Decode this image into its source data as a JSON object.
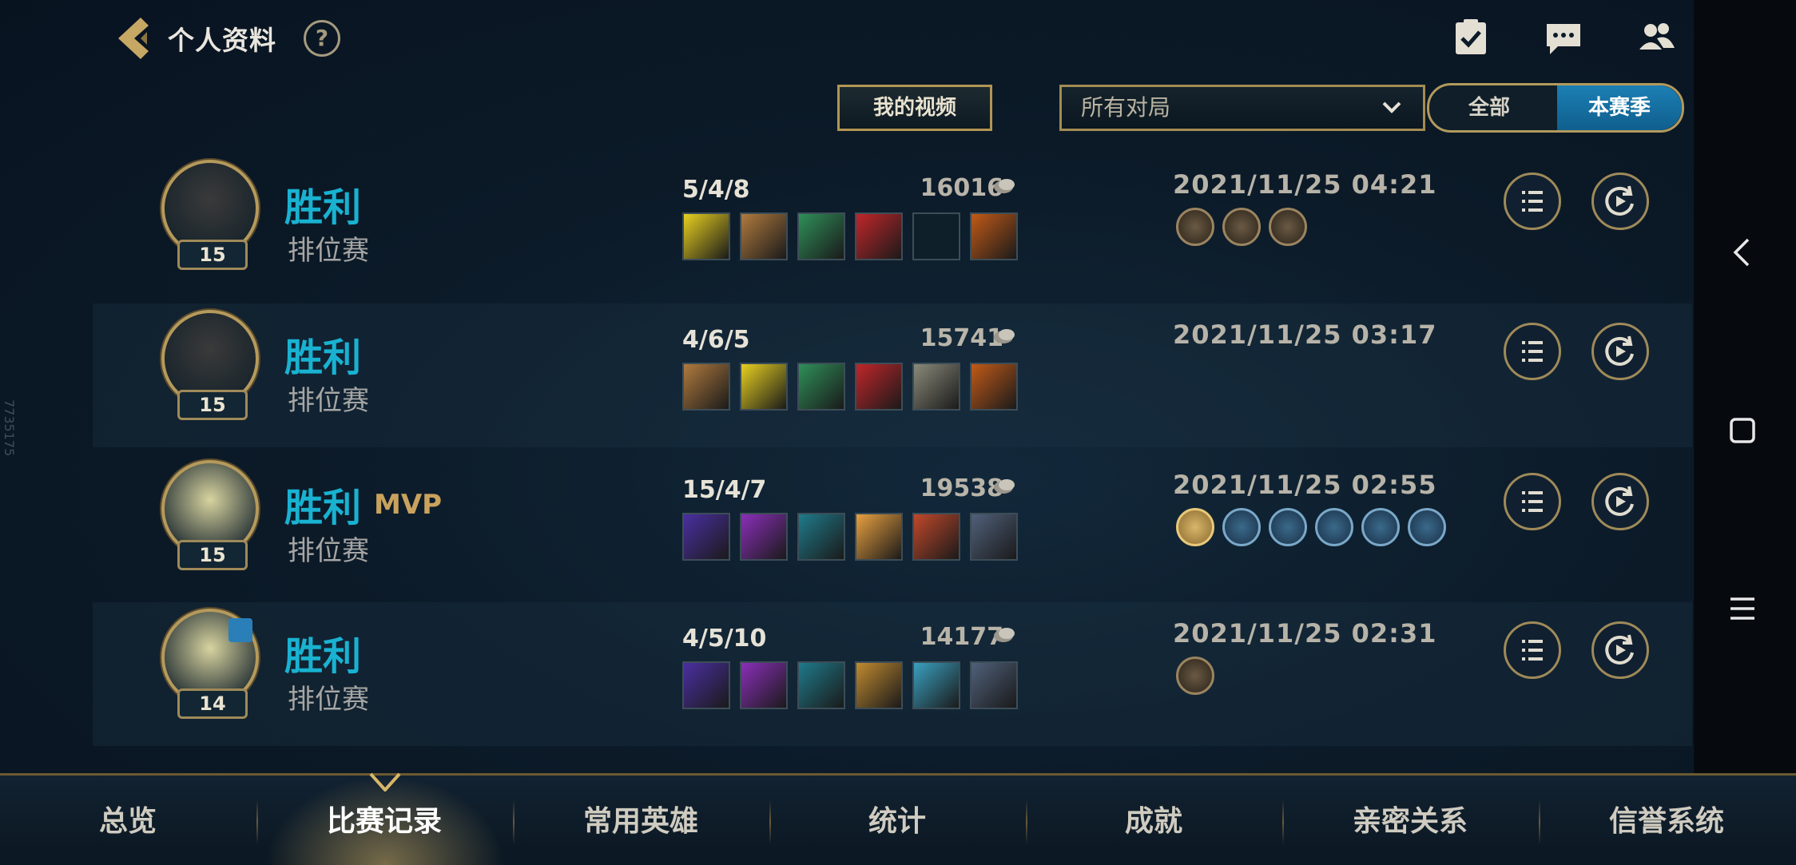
{
  "header": {
    "title": "个人资料",
    "help": "?"
  },
  "filters": {
    "video_button": "我的视频",
    "mode_select": "所有对局",
    "toggle_all": "全部",
    "toggle_season": "本赛季"
  },
  "matches": [
    {
      "result": "胜利",
      "mvp": "",
      "mode": "排位赛",
      "level": "15",
      "kda": "5/4/8",
      "gold": "16016",
      "datetime": "2021/11/25 04:21",
      "items": [
        "item-icon",
        "item-icon",
        "item-icon",
        "item-icon",
        "empty-slot",
        "trinket-icon"
      ],
      "badges": [
        "achievement-badge",
        "achievement-badge",
        "achievement-badge"
      ]
    },
    {
      "result": "胜利",
      "mvp": "",
      "mode": "排位赛",
      "level": "15",
      "kda": "4/6/5",
      "gold": "15741",
      "datetime": "2021/11/25 03:17",
      "items": [
        "item-icon",
        "item-icon",
        "item-icon",
        "item-icon",
        "item-icon",
        "trinket-icon"
      ],
      "badges": []
    },
    {
      "result": "胜利",
      "mvp": "MVP",
      "mode": "排位赛",
      "level": "15",
      "kda": "15/4/7",
      "gold": "19538",
      "datetime": "2021/11/25 02:55",
      "items": [
        "item-icon",
        "item-icon",
        "item-icon",
        "item-icon",
        "item-icon",
        "trinket-icon"
      ],
      "badges": [
        "s-rank-badge",
        "achievement-badge",
        "achievement-badge",
        "achievement-badge",
        "achievement-badge",
        "achievement-badge"
      ]
    },
    {
      "result": "胜利",
      "mvp": "",
      "mode": "排位赛",
      "level": "14",
      "kda": "4/5/10",
      "gold": "14177",
      "datetime": "2021/11/25 02:31",
      "items": [
        "item-icon",
        "item-icon",
        "item-icon",
        "item-icon",
        "item-icon",
        "trinket-icon"
      ],
      "badges": [
        "achievement-badge"
      ]
    }
  ],
  "tabs": [
    "总览",
    "比赛记录",
    "常用英雄",
    "统计",
    "成就",
    "亲密关系",
    "信誉系统"
  ],
  "active_tab": "比赛记录",
  "watermark": "7735175",
  "colors": {
    "win": "#19b2d1",
    "mvp": "#c9a25d",
    "accent_gold": "#b29a5d",
    "toggle_active": "#1c7fb4"
  }
}
